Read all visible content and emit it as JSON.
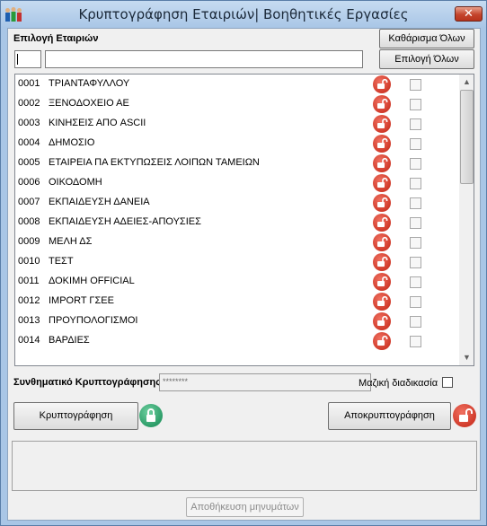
{
  "window": {
    "title": "Κρυπτογράφηση Εταιριών| Βοηθητικές Εργασίες",
    "close_label": "✕",
    "app_icon": "people-icon"
  },
  "company_select": {
    "label": "Επιλογή Εταιριών",
    "clear_all_label": "Καθάρισμα Όλων",
    "select_all_label": "Επιλογή Όλων",
    "code_filter_value": "",
    "name_filter_value": ""
  },
  "companies": [
    {
      "code": "0001",
      "name": "ΤΡΙΑΝΤΑΦΥΛΛΟΥ",
      "checked": false,
      "icon": "lock-open-icon"
    },
    {
      "code": "0002",
      "name": "ΞΕΝΟΔΟΧΕΙΟ ΑΕ",
      "checked": false,
      "icon": "lock-open-icon"
    },
    {
      "code": "0003",
      "name": "ΚΙΝΗΣΕΙΣ ΑΠΟ ASCII",
      "checked": false,
      "icon": "lock-open-icon"
    },
    {
      "code": "0004",
      "name": "ΔΗΜΟΣΙΟ",
      "checked": false,
      "icon": "lock-open-icon"
    },
    {
      "code": "0005",
      "name": "ΕΤΑΙΡΕΙΑ ΠΑ ΕΚΤΥΠΩΣΕΙΣ ΛΟΙΠΩΝ ΤΑΜΕΙΩΝ",
      "checked": false,
      "icon": "lock-open-icon"
    },
    {
      "code": "0006",
      "name": "ΟΙΚΟΔΟΜΗ",
      "checked": false,
      "icon": "lock-open-icon"
    },
    {
      "code": "0007",
      "name": "ΕΚΠΑΙΔΕΥΣΗ ΔΑΝΕΙΑ",
      "checked": false,
      "icon": "lock-open-icon"
    },
    {
      "code": "0008",
      "name": "ΕΚΠΑΙΔΕΥΣΗ ΑΔΕΙΕΣ-ΑΠΟΥΣΙΕΣ",
      "checked": false,
      "icon": "lock-open-icon"
    },
    {
      "code": "0009",
      "name": "ΜΕΛΗ ΔΣ",
      "checked": false,
      "icon": "lock-open-icon"
    },
    {
      "code": "0010",
      "name": "ΤΕΣΤ",
      "checked": false,
      "icon": "lock-open-icon"
    },
    {
      "code": "0011",
      "name": "ΔΟΚΙΜΗ OFFICIAL",
      "checked": false,
      "icon": "lock-open-icon"
    },
    {
      "code": "0012",
      "name": "IMPORT ΓΣΕΕ",
      "checked": false,
      "icon": "lock-open-icon"
    },
    {
      "code": "0013",
      "name": "ΠΡΟΥΠΟΛΟΓΙΣΜΟΙ",
      "checked": false,
      "icon": "lock-open-icon"
    },
    {
      "code": "0014",
      "name": "ΒΑΡΔΙΕΣ",
      "checked": false,
      "icon": "lock-open-icon"
    }
  ],
  "encryption": {
    "password_label": "Συνθηματικό Κρυπτογράφησης",
    "password_value": "********",
    "mass_process_label": "Μαζική διαδικασία",
    "mass_process_checked": false,
    "encrypt_label": "Κρυπτογράφηση",
    "decrypt_label": "Αποκρυπτογράφηση",
    "save_messages_label": "Αποθήκευση μηνυμάτων"
  },
  "colors": {
    "titlebar": "#a9c6e6",
    "close": "#c4442c",
    "lock_open": "#d03a2a",
    "lock_closed": "#2c9c68"
  }
}
